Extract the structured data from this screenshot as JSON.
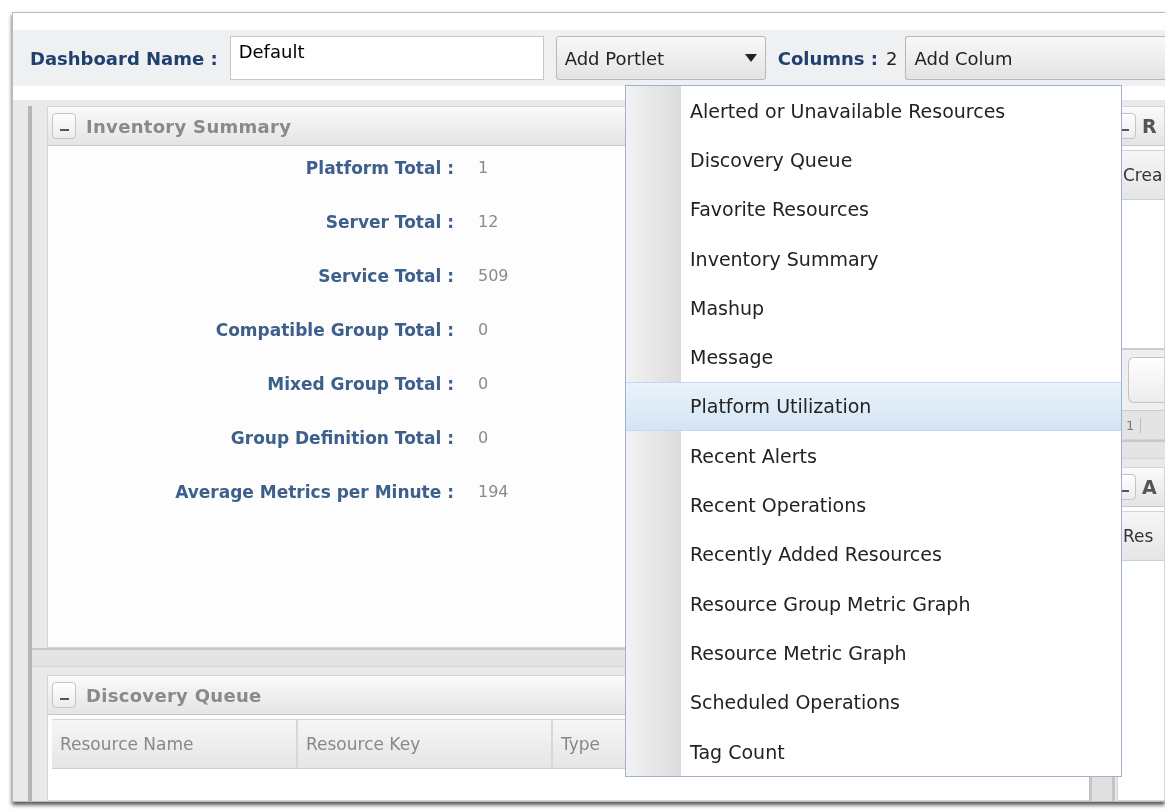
{
  "toolbar": {
    "name_label": "Dashboard Name :",
    "name_value": "Default",
    "add_portlet": "Add Portlet",
    "columns_label": "Columns :",
    "columns_value": "2",
    "add_columns": "Add Colum"
  },
  "left_column": {
    "portlets": [
      {
        "kind": "summary",
        "title": "Inventory Summary",
        "rows": [
          {
            "label": "Platform Total :",
            "value": "1"
          },
          {
            "label": "Server Total :",
            "value": "12"
          },
          {
            "label": "Service Total :",
            "value": "509"
          },
          {
            "label": "Compatible Group Total :",
            "value": "0"
          },
          {
            "label": "Mixed Group Total :",
            "value": "0"
          },
          {
            "label": "Group Definition Total :",
            "value": "0"
          },
          {
            "label": "Average Metrics per Minute :",
            "value": "194"
          }
        ]
      },
      {
        "kind": "table",
        "title": "Discovery Queue",
        "columns": [
          "Resource Name",
          "Resource Key",
          "Type"
        ]
      }
    ]
  },
  "right_column": {
    "portlets": [
      {
        "kind": "paged",
        "title": "R",
        "columns": [
          "Crea"
        ],
        "pager": "1"
      },
      {
        "kind": "table",
        "title": "A",
        "columns": [
          "Res"
        ]
      }
    ]
  },
  "add_portlet_menu": {
    "items": [
      {
        "label": "Alerted or Unavailable Resources",
        "selected": false
      },
      {
        "label": "Discovery Queue",
        "selected": false
      },
      {
        "label": "Favorite Resources",
        "selected": false
      },
      {
        "label": "Inventory Summary",
        "selected": false
      },
      {
        "label": "Mashup",
        "selected": false
      },
      {
        "label": "Message",
        "selected": false
      },
      {
        "label": "Platform Utilization",
        "selected": true
      },
      {
        "label": "Recent Alerts",
        "selected": false
      },
      {
        "label": "Recent Operations",
        "selected": false
      },
      {
        "label": "Recently Added Resources",
        "selected": false
      },
      {
        "label": "Resource Group Metric Graph",
        "selected": false
      },
      {
        "label": "Resource Metric Graph",
        "selected": false
      },
      {
        "label": "Scheduled Operations",
        "selected": false
      },
      {
        "label": "Tag Count",
        "selected": false
      }
    ]
  }
}
